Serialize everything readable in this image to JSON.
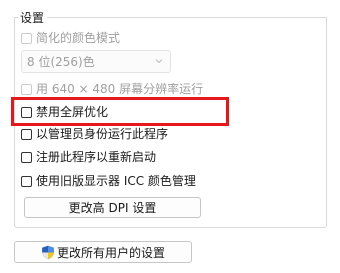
{
  "settings_group": {
    "title": "设置",
    "reduced_color": {
      "label": "简化的颜色模式",
      "checked": false,
      "enabled": false
    },
    "color_select": {
      "value": "8 位(256)色",
      "enabled": false
    },
    "run_640x480": {
      "label": "用 640 × 480 屏幕分辨率运行",
      "checked": false,
      "enabled": false
    },
    "disable_fullscreen_opt": {
      "label": "禁用全屏优化",
      "checked": false,
      "enabled": true
    },
    "run_as_admin": {
      "label": "以管理员身份运行此程序",
      "checked": false,
      "enabled": true
    },
    "register_restart": {
      "label": "注册此程序以重新启动",
      "checked": false,
      "enabled": true
    },
    "legacy_icc": {
      "label": "使用旧版显示器 ICC 颜色管理",
      "checked": false,
      "enabled": true
    },
    "change_dpi_button": "更改高 DPI 设置"
  },
  "all_users_button": "更改所有用户的设置",
  "colors": {
    "highlight": "#e8171c",
    "disabled_text": "#a0a0a0"
  },
  "icons": {
    "chevron": "chevron-down-icon",
    "shield": "uac-shield-icon"
  }
}
